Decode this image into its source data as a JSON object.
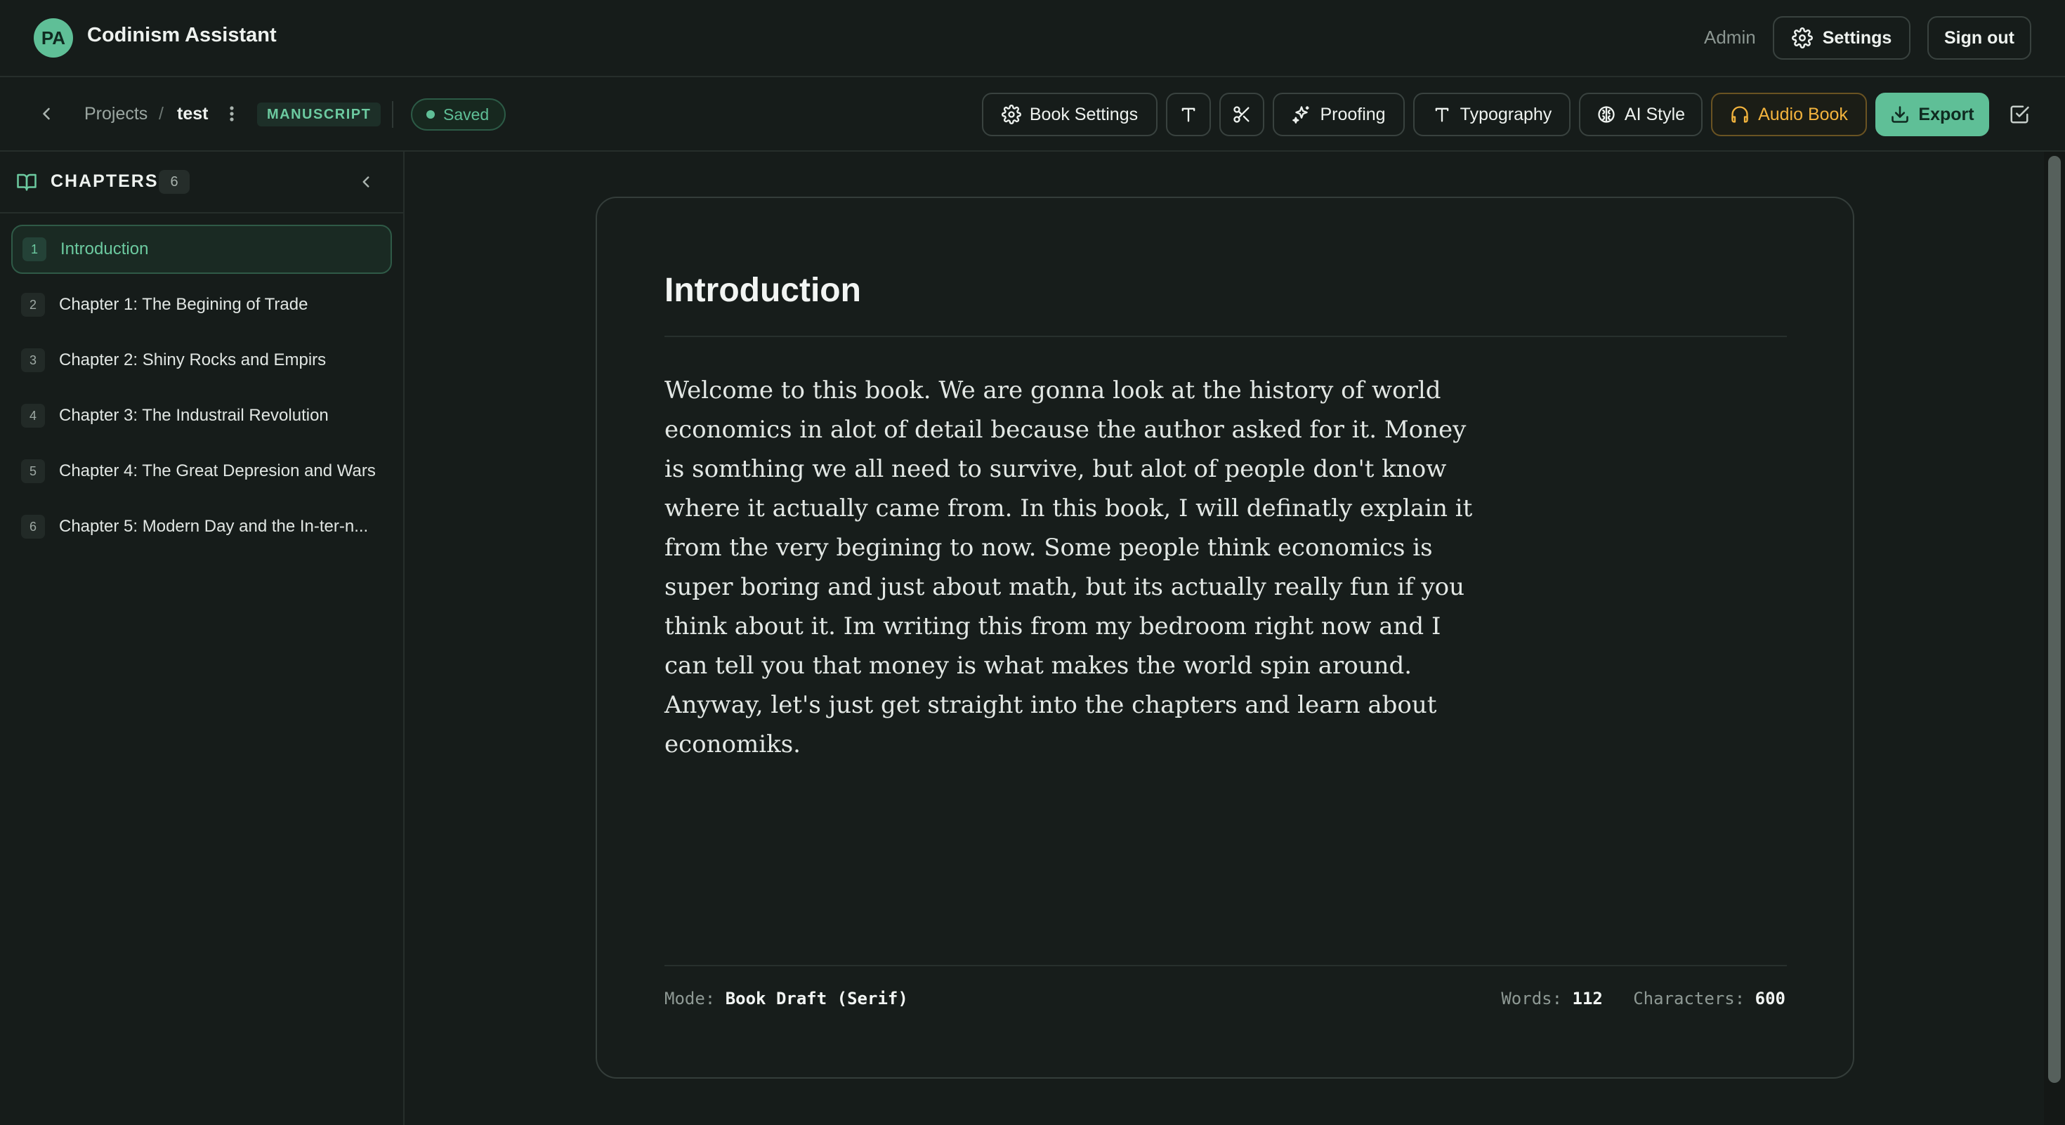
{
  "header": {
    "avatar_initials": "PA",
    "app_title": "Codinism Assistant",
    "role_label": "Admin",
    "settings_label": "Settings",
    "signout_label": "Sign out"
  },
  "toolbar": {
    "breadcrumb": {
      "projects": "Projects",
      "separator": "/",
      "current": "test"
    },
    "mode_badge": "MANUSCRIPT",
    "save_status": "Saved",
    "buttons": {
      "book_settings": "Book Settings",
      "proofing": "Proofing",
      "typography": "Typography",
      "ai_style": "AI Style",
      "audio_book": "Audio Book",
      "export": "Export"
    },
    "icons": [
      "back-chevron-icon",
      "more-vertical-icon",
      "gear-icon",
      "text-icon",
      "scissors-icon",
      "sparkles-icon",
      "brain-icon",
      "headphones-icon",
      "download-icon",
      "check-square-icon"
    ]
  },
  "sidebar": {
    "title": "CHAPTERS",
    "count": "6",
    "chapters": [
      {
        "num": "1",
        "label": "Introduction",
        "active": true
      },
      {
        "num": "2",
        "label": "Chapter 1: The Begining of Trade"
      },
      {
        "num": "3",
        "label": "Chapter 2: Shiny Rocks and Empirs"
      },
      {
        "num": "4",
        "label": "Chapter 3: The Industrail Revolution"
      },
      {
        "num": "5",
        "label": "Chapter 4: The Great Depresion and Wars"
      },
      {
        "num": "6",
        "label": "Chapter 5: Modern Day and the In-ter-n..."
      }
    ]
  },
  "document": {
    "title": "Introduction",
    "body": "Welcome to this book. We are gonna look at the history of world economics in alot of detail because the author asked for it. Money is somthing we all need to survive, but alot of people don't know where it actually came from. In this book, I will definatly explain it from the very begining to now. Some people think economics is super boring and just about math, but its actually really fun if you think about it. Im writing this from my bedroom right now and I can tell you that money is what makes the world spin around. Anyway, let's just get straight into the chapters and learn about economiks.",
    "footer": {
      "mode_label": "Mode:",
      "mode_value": "Book Draft (Serif)",
      "words_label": "Words:",
      "words_value": "112",
      "chars_label": "Characters:",
      "chars_value": "600"
    }
  },
  "colors": {
    "background": "#161c1a",
    "accent_green": "#5fbf97",
    "accent_amber": "#f2b33d",
    "border": "#39423f"
  }
}
